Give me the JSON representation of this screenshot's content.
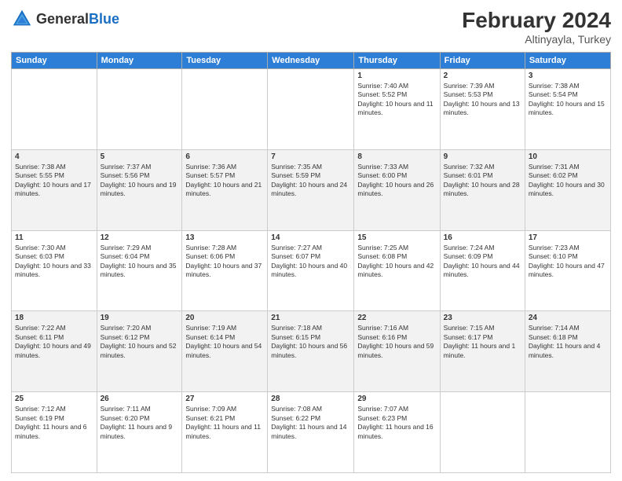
{
  "header": {
    "logo": {
      "general": "General",
      "blue": "Blue"
    },
    "title": "February 2024",
    "subtitle": "Altinyayla, Turkey"
  },
  "weekdays": [
    "Sunday",
    "Monday",
    "Tuesday",
    "Wednesday",
    "Thursday",
    "Friday",
    "Saturday"
  ],
  "weeks": [
    [
      {
        "day": "",
        "info": ""
      },
      {
        "day": "",
        "info": ""
      },
      {
        "day": "",
        "info": ""
      },
      {
        "day": "",
        "info": ""
      },
      {
        "day": "1",
        "info": "Sunrise: 7:40 AM\nSunset: 5:52 PM\nDaylight: 10 hours and 11 minutes."
      },
      {
        "day": "2",
        "info": "Sunrise: 7:39 AM\nSunset: 5:53 PM\nDaylight: 10 hours and 13 minutes."
      },
      {
        "day": "3",
        "info": "Sunrise: 7:38 AM\nSunset: 5:54 PM\nDaylight: 10 hours and 15 minutes."
      }
    ],
    [
      {
        "day": "4",
        "info": "Sunrise: 7:38 AM\nSunset: 5:55 PM\nDaylight: 10 hours and 17 minutes."
      },
      {
        "day": "5",
        "info": "Sunrise: 7:37 AM\nSunset: 5:56 PM\nDaylight: 10 hours and 19 minutes."
      },
      {
        "day": "6",
        "info": "Sunrise: 7:36 AM\nSunset: 5:57 PM\nDaylight: 10 hours and 21 minutes."
      },
      {
        "day": "7",
        "info": "Sunrise: 7:35 AM\nSunset: 5:59 PM\nDaylight: 10 hours and 24 minutes."
      },
      {
        "day": "8",
        "info": "Sunrise: 7:33 AM\nSunset: 6:00 PM\nDaylight: 10 hours and 26 minutes."
      },
      {
        "day": "9",
        "info": "Sunrise: 7:32 AM\nSunset: 6:01 PM\nDaylight: 10 hours and 28 minutes."
      },
      {
        "day": "10",
        "info": "Sunrise: 7:31 AM\nSunset: 6:02 PM\nDaylight: 10 hours and 30 minutes."
      }
    ],
    [
      {
        "day": "11",
        "info": "Sunrise: 7:30 AM\nSunset: 6:03 PM\nDaylight: 10 hours and 33 minutes."
      },
      {
        "day": "12",
        "info": "Sunrise: 7:29 AM\nSunset: 6:04 PM\nDaylight: 10 hours and 35 minutes."
      },
      {
        "day": "13",
        "info": "Sunrise: 7:28 AM\nSunset: 6:06 PM\nDaylight: 10 hours and 37 minutes."
      },
      {
        "day": "14",
        "info": "Sunrise: 7:27 AM\nSunset: 6:07 PM\nDaylight: 10 hours and 40 minutes."
      },
      {
        "day": "15",
        "info": "Sunrise: 7:25 AM\nSunset: 6:08 PM\nDaylight: 10 hours and 42 minutes."
      },
      {
        "day": "16",
        "info": "Sunrise: 7:24 AM\nSunset: 6:09 PM\nDaylight: 10 hours and 44 minutes."
      },
      {
        "day": "17",
        "info": "Sunrise: 7:23 AM\nSunset: 6:10 PM\nDaylight: 10 hours and 47 minutes."
      }
    ],
    [
      {
        "day": "18",
        "info": "Sunrise: 7:22 AM\nSunset: 6:11 PM\nDaylight: 10 hours and 49 minutes."
      },
      {
        "day": "19",
        "info": "Sunrise: 7:20 AM\nSunset: 6:12 PM\nDaylight: 10 hours and 52 minutes."
      },
      {
        "day": "20",
        "info": "Sunrise: 7:19 AM\nSunset: 6:14 PM\nDaylight: 10 hours and 54 minutes."
      },
      {
        "day": "21",
        "info": "Sunrise: 7:18 AM\nSunset: 6:15 PM\nDaylight: 10 hours and 56 minutes."
      },
      {
        "day": "22",
        "info": "Sunrise: 7:16 AM\nSunset: 6:16 PM\nDaylight: 10 hours and 59 minutes."
      },
      {
        "day": "23",
        "info": "Sunrise: 7:15 AM\nSunset: 6:17 PM\nDaylight: 11 hours and 1 minute."
      },
      {
        "day": "24",
        "info": "Sunrise: 7:14 AM\nSunset: 6:18 PM\nDaylight: 11 hours and 4 minutes."
      }
    ],
    [
      {
        "day": "25",
        "info": "Sunrise: 7:12 AM\nSunset: 6:19 PM\nDaylight: 11 hours and 6 minutes."
      },
      {
        "day": "26",
        "info": "Sunrise: 7:11 AM\nSunset: 6:20 PM\nDaylight: 11 hours and 9 minutes."
      },
      {
        "day": "27",
        "info": "Sunrise: 7:09 AM\nSunset: 6:21 PM\nDaylight: 11 hours and 11 minutes."
      },
      {
        "day": "28",
        "info": "Sunrise: 7:08 AM\nSunset: 6:22 PM\nDaylight: 11 hours and 14 minutes."
      },
      {
        "day": "29",
        "info": "Sunrise: 7:07 AM\nSunset: 6:23 PM\nDaylight: 11 hours and 16 minutes."
      },
      {
        "day": "",
        "info": ""
      },
      {
        "day": "",
        "info": ""
      }
    ]
  ]
}
